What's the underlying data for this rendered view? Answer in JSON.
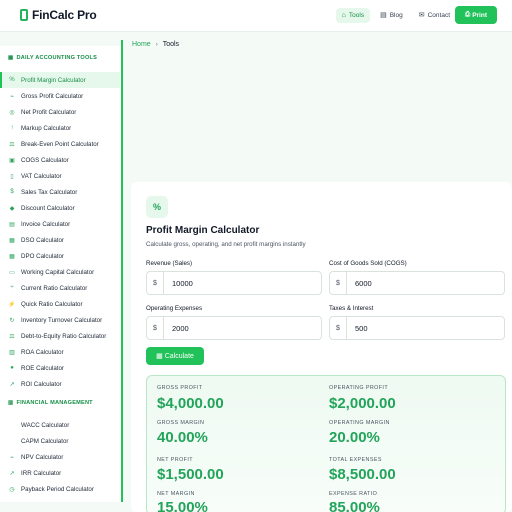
{
  "header": {
    "brand": "FinCalc Pro",
    "nav": [
      {
        "label": "Tools",
        "icon": "home-icon"
      },
      {
        "label": "Blog",
        "icon": "book-icon"
      },
      {
        "label": "Contact",
        "icon": "envelope-icon"
      }
    ],
    "cta_label": "Print"
  },
  "sidebar": {
    "sections": [
      {
        "title": "DAILY ACCOUNTING TOOLS",
        "items": [
          {
            "label": "Profit Margin Calculator",
            "active": true
          },
          {
            "label": "Gross Profit Calculator"
          },
          {
            "label": "Net Profit Calculator"
          },
          {
            "label": "Markup Calculator"
          },
          {
            "label": "Break-Even Point Calculator"
          },
          {
            "label": "COGS Calculator"
          },
          {
            "label": "VAT Calculator"
          },
          {
            "label": "Sales Tax Calculator"
          },
          {
            "label": "Discount Calculator"
          },
          {
            "label": "Invoice Calculator"
          },
          {
            "label": "DSO Calculator"
          },
          {
            "label": "DPO Calculator"
          },
          {
            "label": "Working Capital Calculator"
          },
          {
            "label": "Current Ratio Calculator"
          },
          {
            "label": "Quick Ratio Calculator"
          },
          {
            "label": "Inventory Turnover Calculator"
          },
          {
            "label": "Debt-to-Equity Ratio Calculator"
          },
          {
            "label": "ROA Calculator"
          },
          {
            "label": "ROE Calculator"
          },
          {
            "label": "ROI Calculator"
          }
        ]
      },
      {
        "title": "FINANCIAL MANAGEMENT",
        "items": [
          {
            "label": "WACC Calculator"
          },
          {
            "label": "CAPM Calculator"
          },
          {
            "label": "NPV Calculator"
          },
          {
            "label": "IRR Calculator"
          },
          {
            "label": "Payback Period Calculator"
          }
        ]
      }
    ]
  },
  "breadcrumb": {
    "home": "Home",
    "current": "Tools"
  },
  "tool": {
    "icon": "percent-icon",
    "title": "Profit Margin Calculator",
    "subtitle": "Calculate gross, operating, and net profit margins instantly",
    "fields": {
      "revenue": {
        "label": "Revenue (Sales)",
        "prefix": "$",
        "value": "10000"
      },
      "cogs": {
        "label": "Cost of Goods Sold (COGS)",
        "prefix": "$",
        "value": "6000"
      },
      "opex": {
        "label": "Operating Expenses",
        "prefix": "$",
        "value": "2000"
      },
      "taxes": {
        "label": "Taxes & Interest",
        "prefix": "$",
        "value": "500"
      }
    },
    "calculate_label": "Calculate"
  },
  "results": {
    "gross_profit": {
      "label": "GROSS PROFIT",
      "value": "$4,000.00"
    },
    "operating_profit": {
      "label": "OPERATING PROFIT",
      "value": "$2,000.00"
    },
    "gross_margin": {
      "label": "GROSS MARGIN",
      "value": "40.00%"
    },
    "operating_margin": {
      "label": "OPERATING MARGIN",
      "value": "20.00%"
    },
    "net_profit": {
      "label": "NET PROFIT",
      "value": "$1,500.00"
    },
    "total_expenses": {
      "label": "TOTAL EXPENSES",
      "value": "$8,500.00"
    },
    "net_margin": {
      "label": "NET MARGIN",
      "value": "15.00%"
    },
    "expense_ratio": {
      "label": "EXPENSE RATIO",
      "value": "85.00%"
    }
  },
  "colors": {
    "accent": "#22c25a",
    "accent_dark": "#178f47",
    "accent_soft": "#e6f7ec"
  }
}
